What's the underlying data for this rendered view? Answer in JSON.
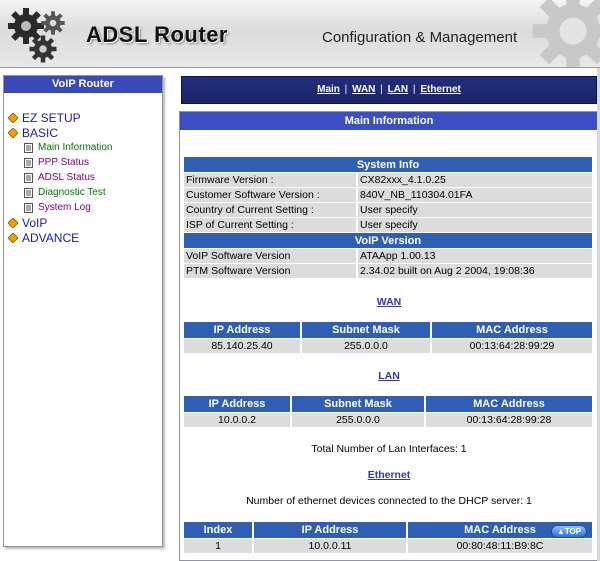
{
  "header": {
    "title": "ADSL Router",
    "subtitle": "Configuration & Management"
  },
  "sidebar": {
    "title": "VoIP Router",
    "items": [
      {
        "label": "EZ SETUP",
        "level": 0
      },
      {
        "label": "BASIC",
        "level": 0
      },
      {
        "label": "Main Information",
        "level": 1,
        "color": "#007a00"
      },
      {
        "label": "PPP Status",
        "level": 1,
        "color": "#880088"
      },
      {
        "label": "ADSL Status",
        "level": 1,
        "color": "#880088"
      },
      {
        "label": "Diagnostic Test",
        "level": 1,
        "color": "#007a00"
      },
      {
        "label": "System Log",
        "level": 1,
        "color": "#880088"
      },
      {
        "label": "VoIP",
        "level": 0
      },
      {
        "label": "ADVANCE",
        "level": 0
      }
    ]
  },
  "nav": {
    "links": [
      "Main",
      "WAN",
      "LAN",
      "Ethernet"
    ],
    "separator": "|"
  },
  "main": {
    "title": "Main Information",
    "system_info": {
      "header": "System Info",
      "rows": [
        {
          "label": "Firmware Version :",
          "value": "CX82xxx_4.1.0.25"
        },
        {
          "label": "Customer Software Version :",
          "value": "840V_NB_110304.01FA"
        },
        {
          "label": "Country of Current Setting :",
          "value": "User specify"
        },
        {
          "label": "ISP of Current Setting :",
          "value": "User specify"
        }
      ]
    },
    "voip_version": {
      "header": "VoIP Version",
      "rows": [
        {
          "label": "VoIP Software Version",
          "value": "ATAApp 1.00.13"
        },
        {
          "label": "PTM Software Version",
          "value": "2.34.02 built on Aug 2 2004, 19:08:36"
        }
      ]
    },
    "wan": {
      "link": "WAN",
      "headers": [
        "IP Address",
        "Subnet Mask",
        "MAC Address"
      ],
      "row": [
        "85.140.25.40",
        "255.0.0.0",
        "00:13:64:28:99:29"
      ]
    },
    "lan": {
      "link": "LAN",
      "headers": [
        "IP Address",
        "Subnet Mask",
        "MAC Address"
      ],
      "row": [
        "10.0.0.2",
        "255.0.0.0",
        "00:13:64:28:99:28"
      ],
      "total_text": "Total Number of Lan Interfaces: 1"
    },
    "ethernet": {
      "link": "Ethernet",
      "count_text": "Number of ethernet devices connected to the DHCP server: 1",
      "headers": [
        "Index",
        "IP Address",
        "MAC Address"
      ],
      "row": [
        "1",
        "10.0.0.11",
        "00:80:48:11:B9:8C"
      ]
    },
    "top_button": "▲TOP"
  },
  "colors": {
    "nav_bg": "#1a2468",
    "table_header": "#2f5fb4",
    "panel_title": "#3c4ec3",
    "cell_bg": "#dcdcdc"
  }
}
